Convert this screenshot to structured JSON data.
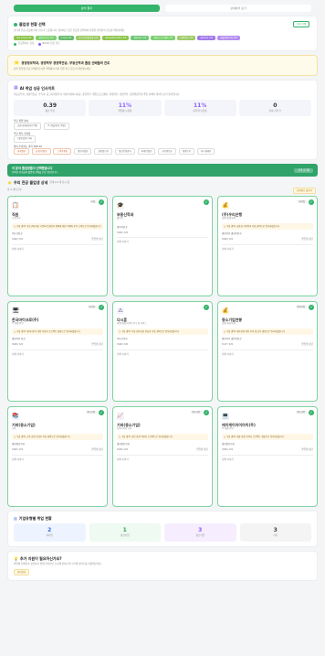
{
  "tabs": [
    {
      "label": "분석 결과"
    },
    {
      "label": "상세분석 보기"
    }
  ],
  "survey": {
    "title": "졸업생 현황 선택",
    "desc": "나타낸 전공 분포에 따라 진로가 노출됩니다. 참여하고 싶은 전공을 선택하여 다양한 선택들의 진로를 확인하세요.",
    "btn": "보정 선택",
    "chips": [
      {
        "label": "부동산학과 1/4",
        "color": "#8bc34a"
      },
      {
        "label": "경영학전공 1/4",
        "color": "#7ccf6f"
      },
      {
        "label": "수학과 1/4",
        "color": "#66bb6a"
      },
      {
        "label": "응고디지털학과 1/4",
        "color": "#9ccc65"
      },
      {
        "label": "데이터엔지니어링 1/4",
        "color": "#8bc34a"
      },
      {
        "label": "경영학부 1/3",
        "color": "#6ec775"
      },
      {
        "label": "게임소프트웨어 1/3",
        "color": "#7ccf6f"
      },
      {
        "label": "현재학부 1/3",
        "color": "#9ccc65"
      },
      {
        "label": "경영학부 2/3",
        "color": "#a078e8"
      },
      {
        "label": "경찰행정학과 4/5",
        "color": "#b48cf0"
      }
    ],
    "legend": [
      {
        "label": "전공일치도 높음",
        "color": "#34b36b"
      },
      {
        "label": "BASIC 전공 진로",
        "color": "#8b5cf6"
      }
    ]
  },
  "notice": {
    "title": "경영정보학과, 경영학부 경영학전공, 부동산학과 졸업 선배들의 진로",
    "text": "선택 졸업생 전공 선배들의 이번 취업에서 어떤 일을 하고 있는지 확인해보세요."
  },
  "alumni": {
    "title": "AI 취업 성공 인사이트",
    "desc": "부동산학과, 경영학전공, 수학과, 응고디지털학과, 데이터엔지니어링, 경영학부, 게임소프트웨어, 현재학부, 경영학부, 경찰행정학과 졸업 선배의 데이터 분석 결과입니다.",
    "stats": [
      {
        "num": "0.39",
        "label": "평균 학점",
        "purple": false
      },
      {
        "num": "11%",
        "label": "취업률 보유율",
        "purple": true
      },
      {
        "num": "11%",
        "label": "대학원 보유율",
        "purple": true
      },
      {
        "num": "0",
        "label": "참여 기관 수",
        "purple": false
      }
    ],
    "field_title": "주요 취업 분야",
    "field_pills": [
      "금융/회계/회계 (7명)",
      "IT 개발/운영 (5명)"
    ],
    "top_title": "주요 취득 자격증",
    "top_pills": [
      "(내용없음) 0개"
    ],
    "cert_title": "많이 수강하는 과목 TOP 10",
    "cert_chips": [
      "회계원론",
      "금융/보험론",
      "고객관계론",
      "경영학원론",
      "경영정보학",
      "생산운영관리",
      "마케팅원론",
      "조직행동론",
      "경영분석",
      "미시경제학"
    ]
  },
  "banner": {
    "title": "이 분야 졸업생들이 선택했습니다",
    "text": "선택한 전공들의 졸업생 선배들 진로 정보입니다",
    "btn": "선택 초기화"
  },
  "major_section": {
    "title": "우리 전공 졸업생 상세",
    "count": "현재 1/4 개 표시 중",
    "filter": "총 9 개의 진로",
    "btn": "상세정보 펼치기"
  },
  "jobs": [
    {
      "title": "직원",
      "sub": "기획/사무",
      "tag": "기획",
      "logo": "📋",
      "logo_bg": "#fff1f1",
      "note": "노 수상 경력: 부동산에 대한 기업의 건설업과 정책에 대한 이해와 분석 능력으로 입사하였습니다",
      "meta1": "부동산전공",
      "meta2": "3.00 / 4.5",
      "meta3": "졸업생 평균",
      "foot": "선배 이야기",
      "fail": false
    },
    {
      "title": "부동산학과",
      "sub": "졸업생",
      "tag": "",
      "logo": "🎓",
      "logo_bg": "#f4f4f4",
      "note": "",
      "meta1": "경영학전공",
      "meta2": "3.00 / 4.5",
      "meta3": "",
      "foot": "선배 이야기",
      "fail": false
    },
    {
      "title": "(주)우리은행",
      "sub": "금융/회계/회계",
      "tag": "대기업",
      "logo": "💰",
      "logo_bg": "#fff6e6",
      "note": "노 수상 경력: 금융권 자격증과 학습 경력으로 입사하였습니다",
      "meta1": "경영학부 경영학전공",
      "meta2": "3.00 / 4.5",
      "meta3": "졸업생 평균",
      "foot": "선배 이야기",
      "fail": false
    },
    {
      "title": "한국마이크로(주)",
      "sub": "IT 개발/운영",
      "tag": "대기업",
      "logo": "🖥",
      "logo_bg": "#eef4ff",
      "note": "노 수상 경력: 데이터분석 관련 학습과 프로젝트 경험으로 입사하였습니다",
      "meta1": "경영학부 전공",
      "meta2": "3.00 / 4.5",
      "meta3": "졸업생 평균",
      "foot": "선배 이야기",
      "fail": false
    },
    {
      "title": "다시훈",
      "sub": "행정/회계/사무직 연구 및 서비스",
      "tag": "",
      "logo": "⚠",
      "logo_bg": "#f4f4ff",
      "note": "노 수상 경력: 부동산에 대한 관심과 학습 경력으로 입사하였습니다",
      "meta1": "부동산학과",
      "meta2": "3.00 / 4.5",
      "meta3": "",
      "foot": "선배 이야기",
      "fail": false
    },
    {
      "title": "중소기업연봉",
      "sub": "금융/회계/회계",
      "tag": "중견기업",
      "logo": "💰",
      "logo_bg": "#fff6e6",
      "note": "노 수상 경력: 재무회계 관련 자격 및 실무 경험으로 입사하였습니다",
      "meta1": "경영학부 경영학전공",
      "meta2": "3.17 / 4.5",
      "meta3": "졸업생 평균",
      "foot": "선배 이야기",
      "fail": false
    },
    {
      "title": "기버(중소기업)",
      "sub": "교육",
      "tag": "중소기업",
      "logo": "📚",
      "logo_bg": "#f6eeff",
      "note": "노 수상 경력: 교육 관련 관심과 학습 경력으로 입사하였습니다",
      "meta1": "경영정보학과",
      "meta2": "3.00 / 4.5",
      "meta3": "졸업생 평균",
      "foot": "선배 이야기",
      "fail": false
    },
    {
      "title": "기버(중소기업)",
      "sub": "현업자학과 교육",
      "tag": "중소기업",
      "logo": "📈",
      "logo_bg": "#eef4ff",
      "note": "노 수상 경력: 현업 관련 역량과 프로젝트로 입사하였습니다",
      "meta1": "경영정보학과",
      "meta2": "3.00 / 4.5",
      "meta3": "졸업생 평균",
      "foot": "선배 이야기",
      "fail": false
    },
    {
      "title": "에이케이아이아이(주)",
      "sub": "IT 개발/운영",
      "tag": "중소기업",
      "logo": "💻",
      "logo_bg": "#eef4ff",
      "note": "노 수상 경력: 개발 관련 자격과 프로젝트 경험으로 입사하였습니다",
      "meta1": "경영정보학과",
      "meta2": "3.00 / 4.5",
      "meta3": "졸업생 평균",
      "foot": "선배 이야기",
      "fail": false
    }
  ],
  "company_size": {
    "title": "기업유형별 취업 현황",
    "items": [
      {
        "num": "2",
        "label": "대기업",
        "bg": "#eef4ff",
        "color": "#3b6fd8"
      },
      {
        "num": "1",
        "label": "중견기업",
        "bg": "#eefaf2",
        "color": "#2f9e5c"
      },
      {
        "num": "3",
        "label": "중소기업",
        "bg": "#f6eeff",
        "color": "#8b5cf6"
      },
      {
        "num": "3",
        "label": "기타",
        "bg": "#f4f4f4",
        "color": "#444"
      }
    ]
  },
  "help": {
    "title": "추가 지원이 필요하신가요?",
    "text": "졸업생 선배들과 상담하기 위해 전담자인 조교에 물어보거나 아래 서비스를 이용해보세요.",
    "btn": "취업상담"
  }
}
